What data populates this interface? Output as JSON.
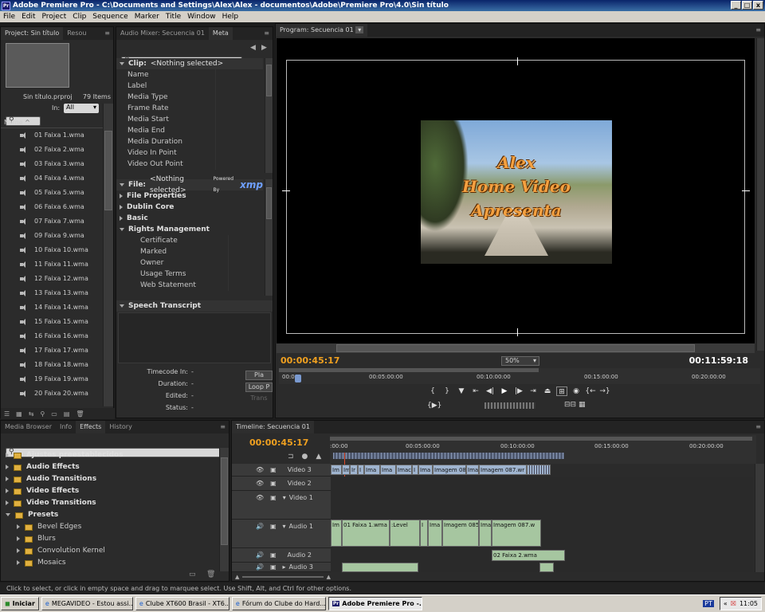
{
  "window": {
    "title": "Adobe Premiere Pro - C:\\Documents and Settings\\Alex\\Alex - documentos\\Adobe\\Premiere Pro\\4.0\\Sin título",
    "app_icon": "Pr"
  },
  "menu": [
    "File",
    "Edit",
    "Project",
    "Clip",
    "Sequence",
    "Marker",
    "Title",
    "Window",
    "Help"
  ],
  "project": {
    "tabs": [
      "Project: Sin título",
      "Resou"
    ],
    "file": "Sin título.prproj",
    "count": "79 Items",
    "in_label": "In:",
    "in_value": "All",
    "col_name": "Name",
    "items": [
      "01 Faixa 1.wma",
      "02 Faixa 2.wma",
      "03 Faixa 3.wma",
      "04 Faixa 4.wma",
      "05 Faixa 5.wma",
      "06 Faixa 6.wma",
      "07 Faixa 7.wma",
      "09 Faixa 9.wma",
      "10 Faixa 10.wma",
      "11 Faixa 11.wma",
      "12 Faixa 12.wma",
      "13 Faixa 13.wma",
      "14 Faixa 14.wma",
      "15 Faixa 15.wma",
      "16 Faixa 16.wma",
      "17 Faixa 17.wma",
      "18 Faixa 18.wma",
      "19 Faixa 19.wma",
      "20 Faixa 20.wma"
    ]
  },
  "metadata": {
    "tabs": [
      "Audio Mixer: Secuencia 01",
      "Meta"
    ],
    "clip_header": "Clip:",
    "clip_value": "<Nothing selected>",
    "clip_fields": [
      "Name",
      "Label",
      "Media Type",
      "Frame Rate",
      "Media Start",
      "Media End",
      "Media Duration",
      "Video In Point",
      "Video Out Point"
    ],
    "file_header": "File:",
    "file_value": "<Nothing selected>",
    "powered": "Powered By",
    "xmp": "xmp",
    "file_sections": [
      {
        "label": "File Properties",
        "open": false
      },
      {
        "label": "Dublin Core",
        "open": false
      },
      {
        "label": "Basic",
        "open": false
      },
      {
        "label": "Rights Management",
        "open": true
      }
    ],
    "rights_fields": [
      "Certificate",
      "Marked",
      "Owner",
      "Usage Terms",
      "Web Statement"
    ],
    "speech": "Speech Transcript",
    "timecode_labels": [
      "Timecode In:",
      "Duration:",
      "Edited:",
      "Status:"
    ],
    "timecode_values": [
      "-",
      "-",
      "-",
      "-"
    ],
    "btn_play": "Pla",
    "btn_loop": "Loop P",
    "btn_trans": "Trans"
  },
  "program": {
    "tab": "Program: Secuencia 01",
    "title_lines": [
      "Alex",
      "Home Video",
      "Apresenta"
    ],
    "timecode": "00:00:45:17",
    "zoom": "50%",
    "duration": "00:11:59:18",
    "ruler": [
      "00:00",
      "00:05:00:00",
      "00:10:00:00",
      "00:15:00:00",
      "00:20:00:00"
    ]
  },
  "effects": {
    "tabs": [
      "Media Browser",
      "Info",
      "Effects",
      "History"
    ],
    "items": [
      {
        "label": "Ajustes preestablecidos",
        "level": 0,
        "bold": true
      },
      {
        "label": "Audio Effects",
        "level": 0,
        "bold": true
      },
      {
        "label": "Audio Transitions",
        "level": 0,
        "bold": true
      },
      {
        "label": "Video Effects",
        "level": 0,
        "bold": true
      },
      {
        "label": "Video Transitions",
        "level": 0,
        "bold": true
      },
      {
        "label": "Presets",
        "level": 0,
        "bold": true,
        "open": true
      },
      {
        "label": "Bevel Edges",
        "level": 1,
        "bold": false
      },
      {
        "label": "Blurs",
        "level": 1,
        "bold": false
      },
      {
        "label": "Convolution Kernel",
        "level": 1,
        "bold": false
      },
      {
        "label": "Mosaics",
        "level": 1,
        "bold": false
      }
    ]
  },
  "timeline": {
    "tab": "Timeline: Secuencia 01",
    "timecode": "00:00:45:17",
    "ruler": [
      ":00:00",
      "00:05:00:00",
      "00:10:00:00",
      "00:15:00:00",
      "00:20:00:00"
    ],
    "tracks": [
      "Video 3",
      "Video 2",
      "Video 1",
      "Audio 1",
      "Audio 2",
      "Audio 3"
    ],
    "clips_v3": [
      "Im",
      "Im",
      "Ir",
      "I",
      "Ima",
      "Ima",
      "Imac",
      "I",
      "Ima",
      "Imagem 08!",
      "Ima",
      "Imagem 087.wr"
    ],
    "clips_a1": [
      "Im",
      "01 Faixa 1.wma",
      ":Level",
      "I",
      "Ima",
      "Imagem 085",
      "Ima",
      "Imagem 087.w"
    ],
    "clips_a2": [
      "02 Faixa 2.wma"
    ]
  },
  "status": "Click to select, or click in empty space and drag to marquee select. Use Shift, Alt, and Ctrl for other options.",
  "taskbar": {
    "start": "Iniciar",
    "items": [
      "MEGAVIDEO - Estou assi...",
      "Clube XT600 Brasil - XT6...",
      "Fórum do Clube do Hard...",
      "Adobe Premiere Pro -..."
    ],
    "lang": "PT",
    "time": "11:05"
  }
}
